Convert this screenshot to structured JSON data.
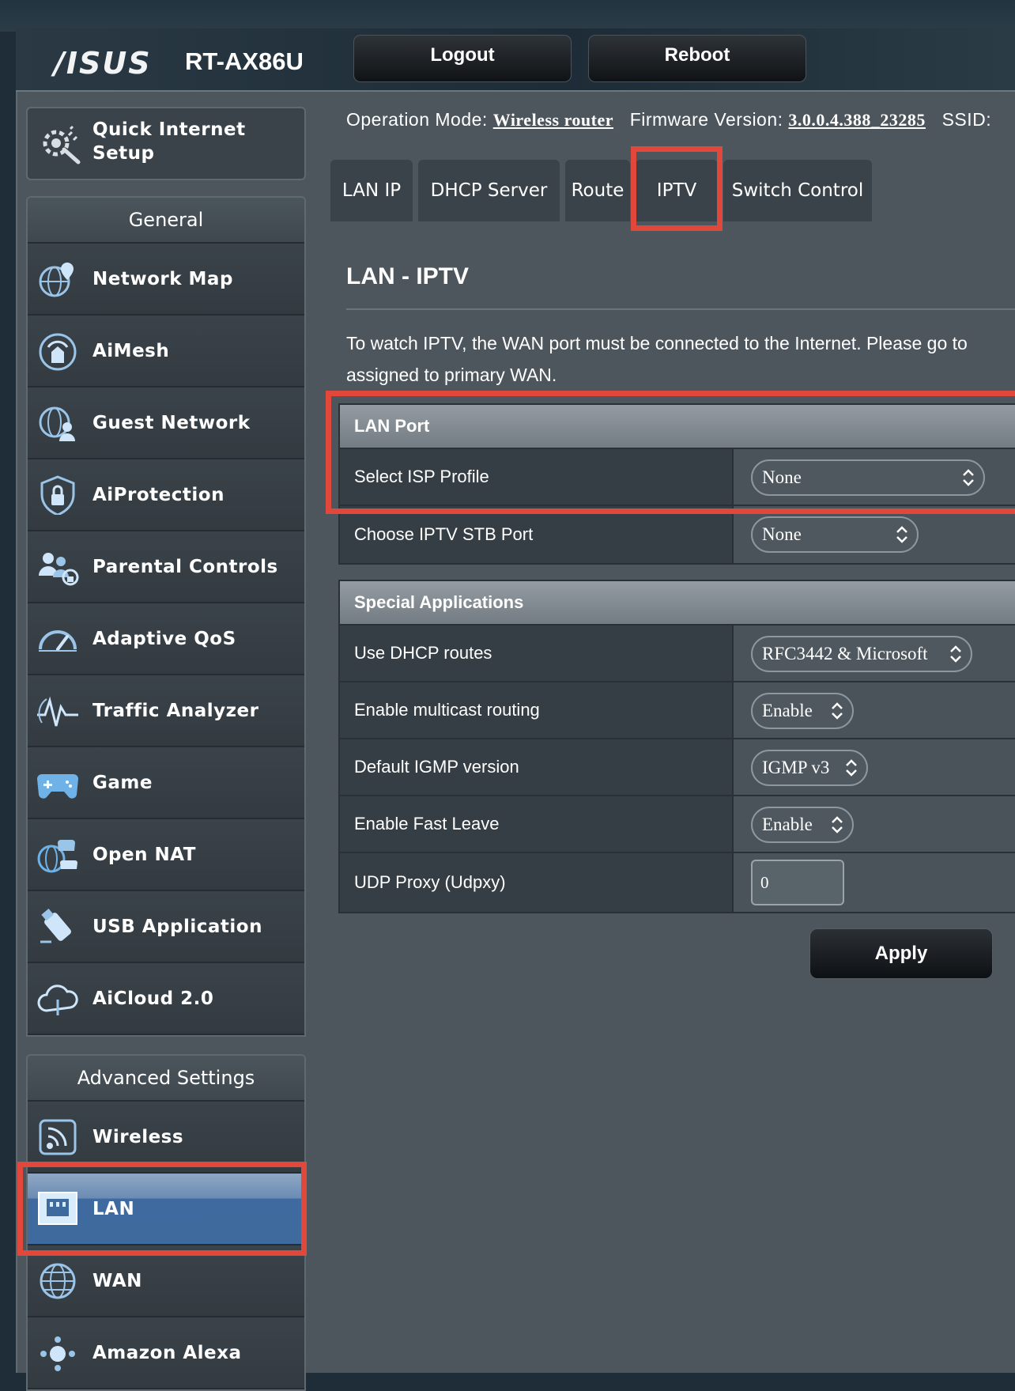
{
  "header": {
    "logo": "/ISUS",
    "model": "RT-AX86U",
    "logout_label": "Logout",
    "reboot_label": "Reboot"
  },
  "info": {
    "op_mode_label": "Operation Mode:",
    "op_mode_value": "Wireless router",
    "fw_label": "Firmware Version:",
    "fw_value": "3.0.0.4.388_23285",
    "ssid_label": "SSID:"
  },
  "sidebar": {
    "qis_line1": "Quick Internet",
    "qis_line2": "Setup",
    "general_title": "General",
    "general_items": [
      {
        "label": "Network Map",
        "icon": "network-map-icon"
      },
      {
        "label": "AiMesh",
        "icon": "aimesh-icon"
      },
      {
        "label": "Guest Network",
        "icon": "guest-network-icon"
      },
      {
        "label": "AiProtection",
        "icon": "shield-lock-icon"
      },
      {
        "label": "Parental Controls",
        "icon": "parental-controls-icon"
      },
      {
        "label": "Adaptive QoS",
        "icon": "gauge-icon"
      },
      {
        "label": "Traffic Analyzer",
        "icon": "traffic-analyzer-icon"
      },
      {
        "label": "Game",
        "icon": "gamepad-icon"
      },
      {
        "label": "Open NAT",
        "icon": "open-nat-icon"
      },
      {
        "label": "USB Application",
        "icon": "usb-icon"
      },
      {
        "label": "AiCloud 2.0",
        "icon": "cloud-icon"
      }
    ],
    "advanced_title": "Advanced Settings",
    "advanced_items": [
      {
        "label": "Wireless",
        "icon": "wireless-icon"
      },
      {
        "label": "LAN",
        "icon": "lan-icon",
        "active": true
      },
      {
        "label": "WAN",
        "icon": "globe-icon"
      },
      {
        "label": "Amazon Alexa",
        "icon": "alexa-icon"
      }
    ]
  },
  "tabs": [
    "LAN IP",
    "DHCP Server",
    "Route",
    "IPTV",
    "Switch Control"
  ],
  "active_tab": "IPTV",
  "page": {
    "title": "LAN - IPTV",
    "desc_line1": "To watch IPTV, the WAN port must be connected to the Internet. Please go to",
    "desc_line2": "assigned to primary WAN."
  },
  "lan_port": {
    "heading": "LAN Port",
    "rows": [
      {
        "label": "Select ISP Profile",
        "value": "None"
      },
      {
        "label": "Choose IPTV STB Port",
        "value": "None"
      }
    ]
  },
  "special": {
    "heading": "Special Applications",
    "rows": [
      {
        "label": "Use DHCP routes",
        "value": "RFC3442 & Microsoft"
      },
      {
        "label": "Enable multicast routing",
        "value": "Enable"
      },
      {
        "label": "Default IGMP version",
        "value": "IGMP v3"
      },
      {
        "label": "Enable Fast Leave",
        "value": "Enable"
      },
      {
        "label": "UDP Proxy (Udpxy)",
        "value": "0"
      }
    ]
  },
  "apply_label": "Apply",
  "colors": {
    "highlight": "#e2473b",
    "active_item": "#3e6a9d",
    "panel": "#4d565d"
  }
}
